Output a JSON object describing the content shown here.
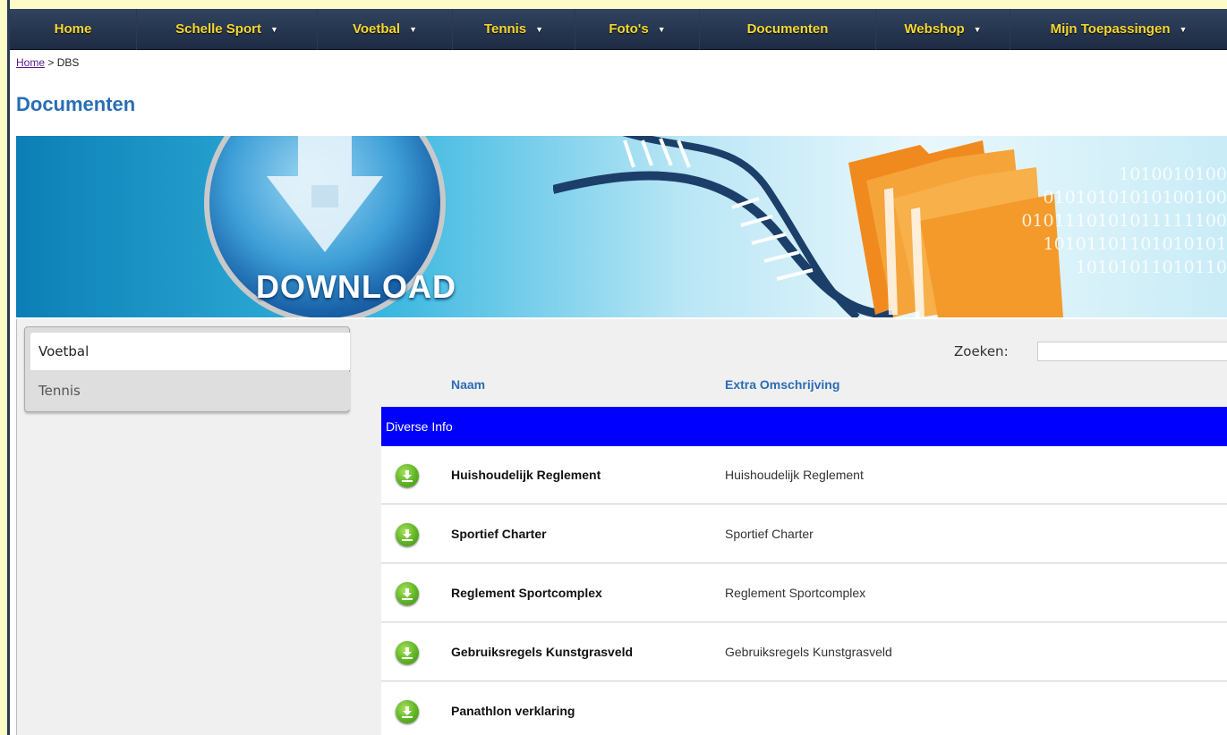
{
  "nav": [
    {
      "label": "Home",
      "caret": false
    },
    {
      "label": "Schelle Sport",
      "caret": true
    },
    {
      "label": "Voetbal",
      "caret": true
    },
    {
      "label": "Tennis",
      "caret": true
    },
    {
      "label": "Foto's",
      "caret": true
    },
    {
      "label": "Documenten",
      "caret": false
    },
    {
      "label": "Webshop",
      "caret": true
    },
    {
      "label": "Mijn Toepassingen",
      "caret": true
    }
  ],
  "breadcrumb": {
    "home": "Home",
    "sep": " > ",
    "current": "DBS"
  },
  "page_title": "Documenten",
  "banner": {
    "download_text": "DOWNLOAD",
    "binary": [
      "1010010100",
      "01010101010100100",
      "0101110101011111100",
      "10101101101010101",
      "10101011010110"
    ]
  },
  "sidebar": {
    "tabs": [
      {
        "label": "Voetbal"
      },
      {
        "label": "Tennis"
      }
    ]
  },
  "search": {
    "label": "Zoeken:",
    "value": ""
  },
  "table": {
    "columns": [
      "Naam",
      "Extra Omschrijving"
    ],
    "group": "Diverse Info",
    "rows": [
      {
        "name": "Huishoudelijk Reglement",
        "desc": "Huishoudelijk Reglement"
      },
      {
        "name": "Sportief Charter",
        "desc": "Sportief Charter"
      },
      {
        "name": "Reglement Sportcomplex",
        "desc": "Reglement Sportcomplex"
      },
      {
        "name": "Gebruiksregels Kunstgrasveld",
        "desc": "Gebruiksregels Kunstgrasveld"
      },
      {
        "name": "Panathlon verklaring",
        "desc": ""
      }
    ]
  },
  "colors": {
    "nav_text": "#f7d830",
    "title": "#2a6db5",
    "group_row": "#0000ff",
    "download_icon": "#5fb524"
  }
}
